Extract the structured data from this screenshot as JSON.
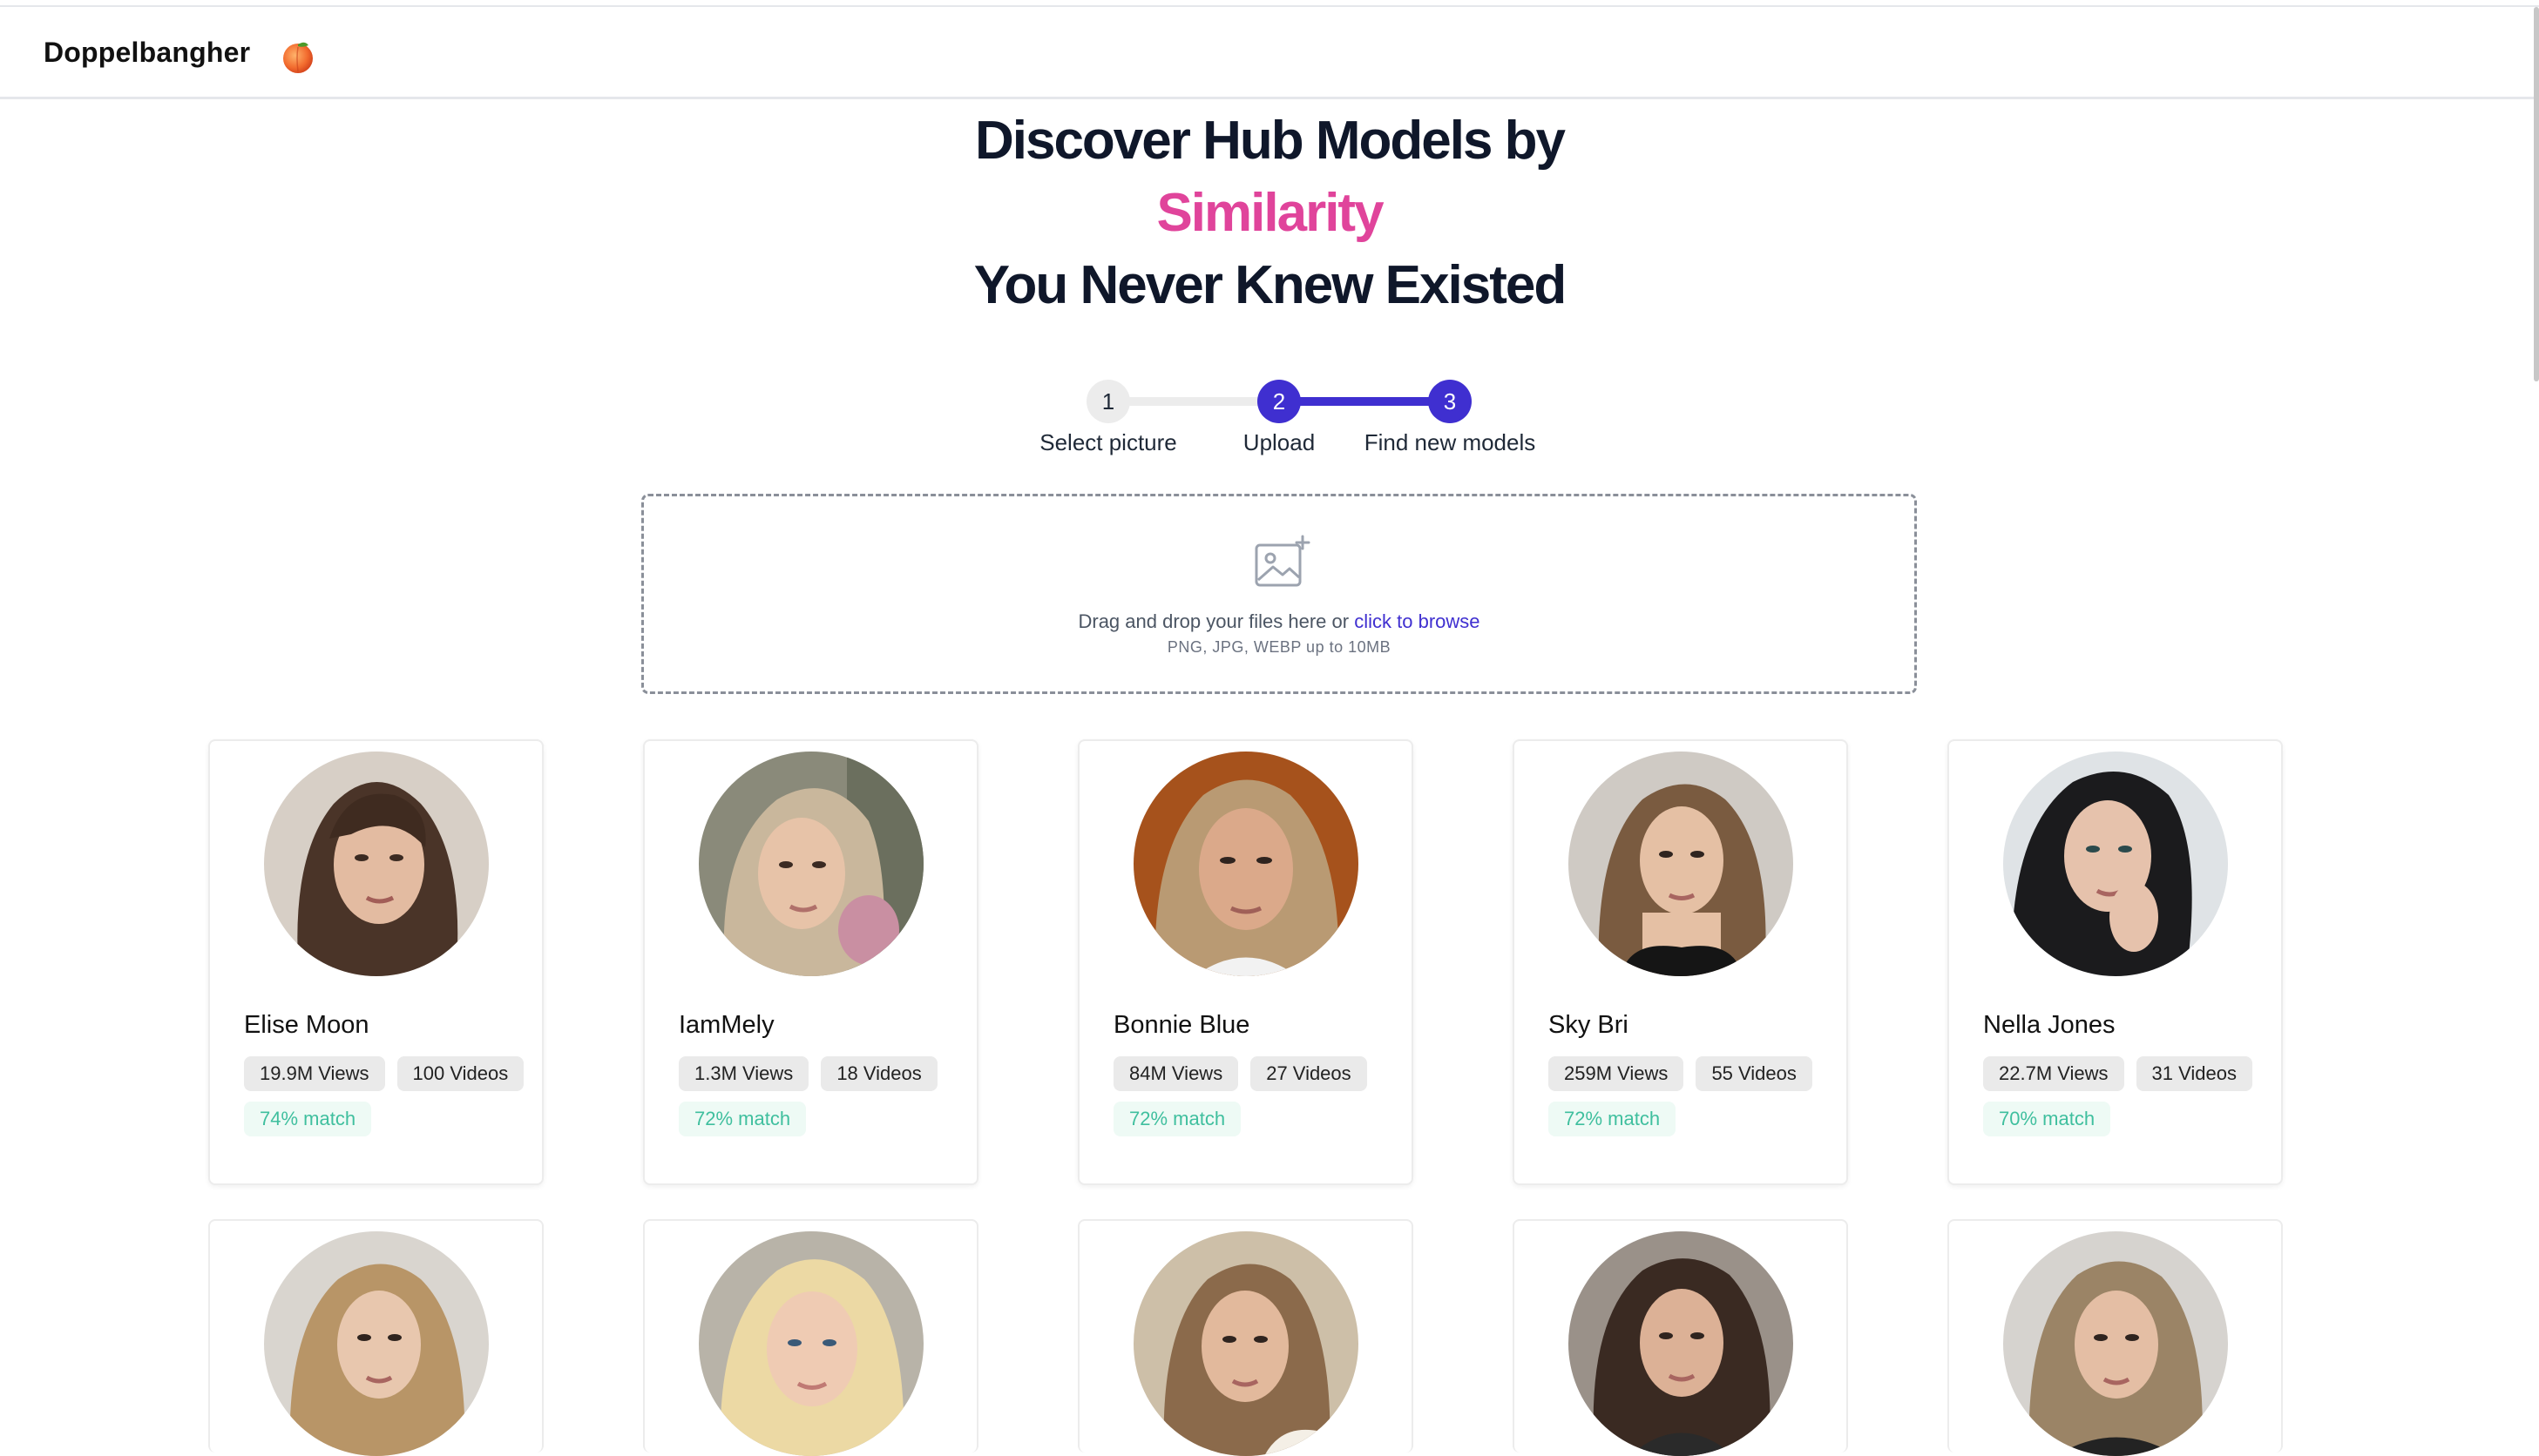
{
  "nav": {
    "brand": "Doppelbangher",
    "brand_emoji": "peach-icon"
  },
  "hero": {
    "line1": "Discover Hub Models by",
    "accent": "Similarity",
    "line3": "You Never Knew Existed",
    "accent_color": "#e0449b"
  },
  "stepper": {
    "active_color": "#3f2fd0",
    "steps": [
      {
        "number": "1",
        "label": "Select picture"
      },
      {
        "number": "2",
        "label": "Upload"
      },
      {
        "number": "3",
        "label": "Find new models"
      }
    ]
  },
  "upload": {
    "icon": "image-add-icon",
    "text": "Drag and drop your files here or",
    "link": "click to browse",
    "hint": "PNG, JPG, WEBP up to 10MB"
  },
  "models": [
    {
      "name": "Elise Moon",
      "views": "19.9M Views",
      "videos": "100 Videos",
      "match": "74% match"
    },
    {
      "name": "IamMely",
      "views": "1.3M Views",
      "videos": "18 Videos",
      "match": "72% match"
    },
    {
      "name": "Bonnie Blue",
      "views": "84M Views",
      "videos": "27 Videos",
      "match": "72% match"
    },
    {
      "name": "Sky Bri",
      "views": "259M Views",
      "videos": "55 Videos",
      "match": "72% match"
    },
    {
      "name": "Nella Jones",
      "views": "22.7M Views",
      "videos": "31 Videos",
      "match": "70% match"
    }
  ]
}
